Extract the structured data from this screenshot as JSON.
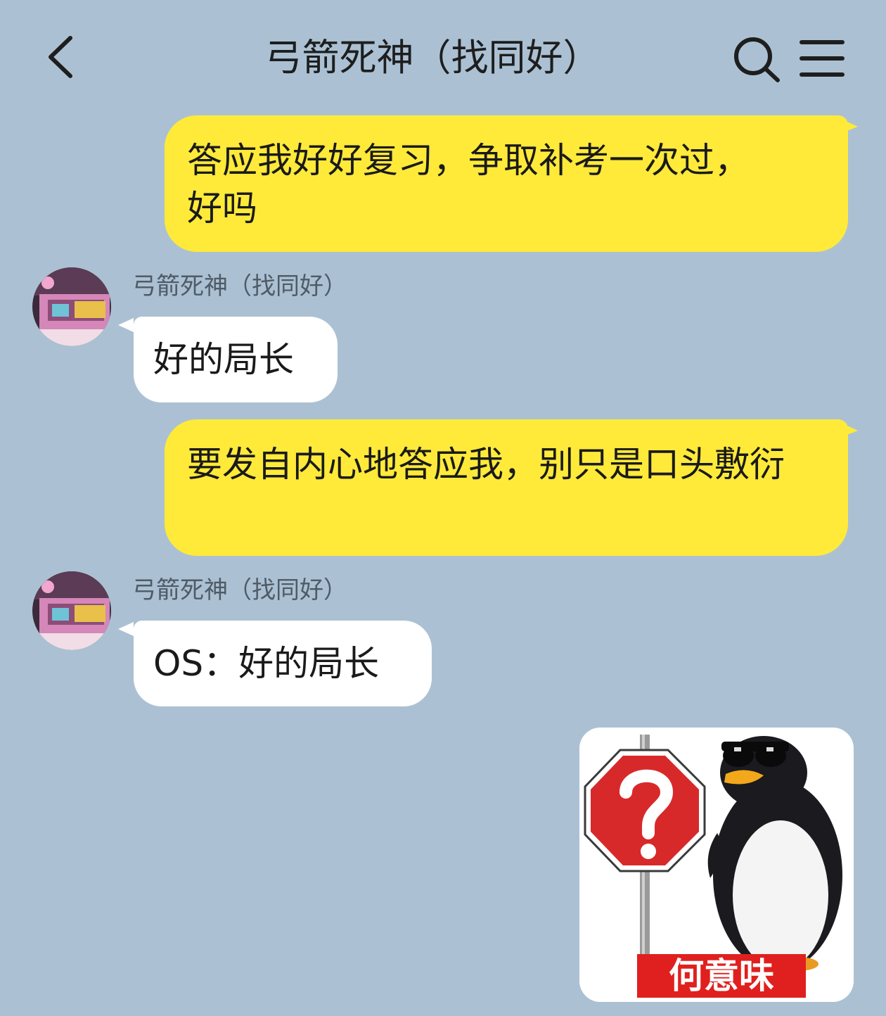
{
  "header": {
    "title": "弓箭死神（找同好）",
    "back_icon": "chevron-left-icon",
    "search_icon": "search-icon",
    "menu_icon": "menu-icon"
  },
  "messages": [
    {
      "direction": "outgoing",
      "text": "答应我好好复习，争取补考一次过，好吗"
    },
    {
      "direction": "incoming",
      "sender": "弓箭死神（找同好）",
      "text": "好的局长"
    },
    {
      "direction": "outgoing",
      "text": "要发自内心地答应我，别只是口头敷衍"
    },
    {
      "direction": "incoming",
      "sender": "弓箭死神（找同好）",
      "text": "OS：好的局长"
    },
    {
      "direction": "outgoing",
      "type": "sticker",
      "sticker_caption": "何意味",
      "sticker_icon": "question-sign-penguin-icon"
    }
  ],
  "colors": {
    "background": "#abc1d3",
    "outgoing_bubble": "#ffea3a",
    "incoming_bubble": "#ffffff",
    "sticker_banner": "#e0201e"
  }
}
